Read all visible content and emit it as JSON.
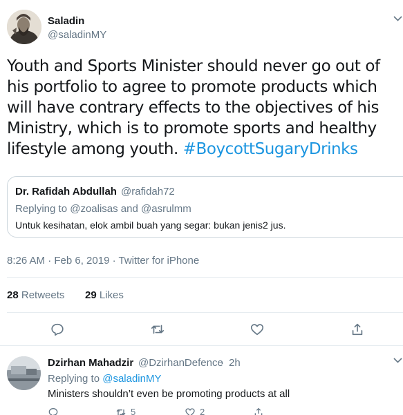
{
  "tweet": {
    "author": {
      "name": "Saladin",
      "handle": "@saladinMY",
      "avatar_icon": "portrait-avatar-icon"
    },
    "text": "Youth and Sports Minister should never go out of his portfolio to agree to promote products which will have contrary effects to the objectives of his Ministry, which is to promote sports and healthy lifestyle among youth.",
    "hashtag": "#BoycottSugaryDrinks",
    "quoted": {
      "name": "Dr. Rafidah Abdullah",
      "handle": "@rafidah72",
      "replying_prefix": "Replying to",
      "replying_handles": "@zoalisas and @asrulmm",
      "text": "Untuk kesihatan, elok ambil buah yang segar: bukan jenis2 jus."
    },
    "timestamp": "8:26 AM · Feb 6, 2019 · Twitter for iPhone",
    "stats": {
      "retweets_count": "28",
      "retweets_label": "Retweets",
      "likes_count": "29",
      "likes_label": "Likes"
    },
    "actions": [
      "reply-icon",
      "retweet-icon",
      "like-icon",
      "share-icon"
    ]
  },
  "reply": {
    "name": "Dzirhan Mahadzir",
    "handle": "@DzirhanDefence",
    "separator": "·",
    "time": "2h",
    "replying_prefix": "Replying to",
    "replying_handle": "@saladinMY",
    "text": "Ministers shouldn’t even be promoting products at all",
    "counts": {
      "retweets": "5",
      "likes": "2"
    }
  },
  "colors": {
    "text": "#14171a",
    "secondary": "#657786",
    "accent": "#1b95e0",
    "border": "#e6ecf0"
  }
}
